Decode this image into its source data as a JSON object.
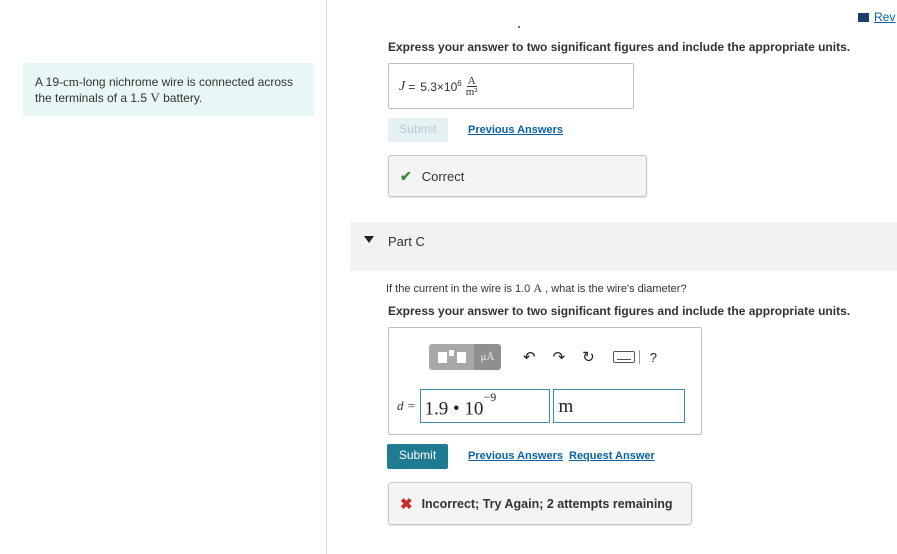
{
  "problem": {
    "before_unit1": "A 19-",
    "unit1": "cm",
    "middle": "-long nichrome wire is connected across the terminals of a 1.5 ",
    "unit2": "V",
    "after": " battery."
  },
  "header": {
    "rev_link": "Rev"
  },
  "part_b": {
    "instructions": "Express your answer to two significant figures and include the appropriate units.",
    "answer": {
      "variable": "J",
      "equals": "=",
      "mantissa": "5.3×10",
      "exponent": "6",
      "unit_num": "A",
      "unit_den": "m²"
    },
    "submit_label": "Submit",
    "previous_answers": "Previous Answers",
    "feedback": "Correct"
  },
  "part_c": {
    "title": "Part C",
    "question_before": "If the current in the wire is 1.0 ",
    "question_unit": "A",
    "question_after": " , what is the wire's diameter?",
    "instructions": "Express your answer to two significant figures and include the appropriate units.",
    "toolbar": {
      "units_label": "μÅ",
      "undo": "↶",
      "redo": "↷",
      "reset": "↻",
      "help": "?"
    },
    "input_label": "d =",
    "value": "1.9 • 10",
    "exponent": "−9",
    "unit": "m",
    "submit_label": "Submit",
    "previous_answers": "Previous Answers",
    "request_answer": "Request Answer",
    "feedback": "Incorrect; Try Again; 2 attempts remaining"
  },
  "colors": {
    "problem_bg": "#e8f6f6",
    "link": "#0b61a4",
    "submit_bg": "#1e7b91",
    "correct": "#3d8b37",
    "incorrect": "#c62b2b"
  }
}
